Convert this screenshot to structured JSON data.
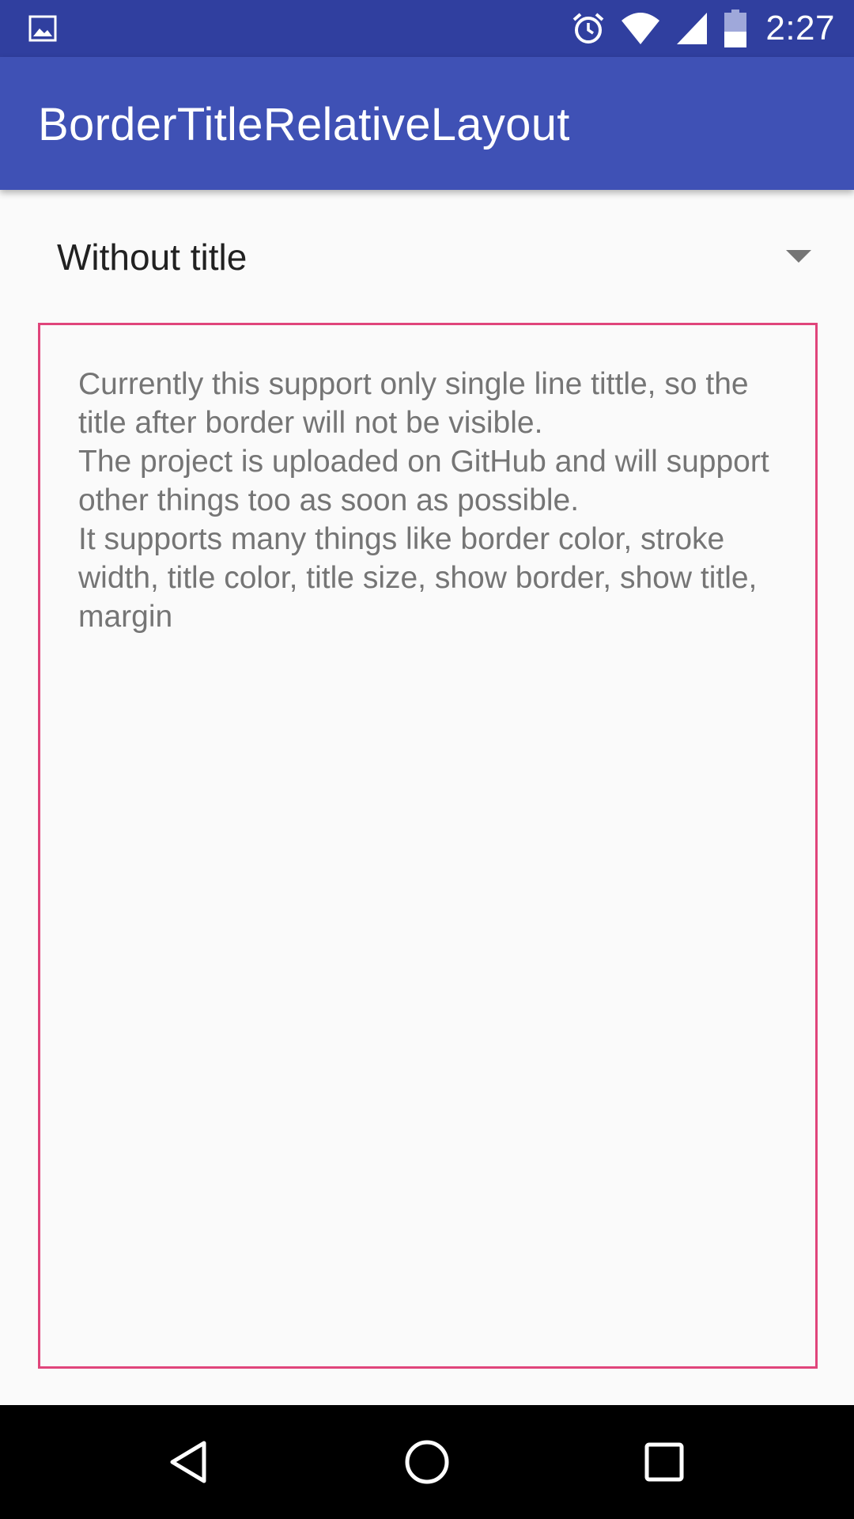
{
  "status_bar": {
    "time": "2:27",
    "icons": [
      "image-notification-icon",
      "alarm-icon",
      "wifi-icon",
      "cell-signal-icon",
      "battery-icon"
    ],
    "background": "#303f9f"
  },
  "app_bar": {
    "title": "BorderTitleRelativeLayout",
    "background": "#3f51b5"
  },
  "spinner": {
    "selected_value": "Without title",
    "icon": "dropdown-arrow-icon"
  },
  "bordered_layout": {
    "border_color": "#e0457b",
    "text": "Currently this support only single line tittle, so the title after border will not be visible.\n The project is uploaded on GitHub and will support other things too as soon as possible.\n It supports many things like border color, stroke width, title color, title size, show border, show title, margin"
  },
  "nav_bar": {
    "buttons": [
      "back-icon",
      "home-icon",
      "recents-icon"
    ]
  }
}
